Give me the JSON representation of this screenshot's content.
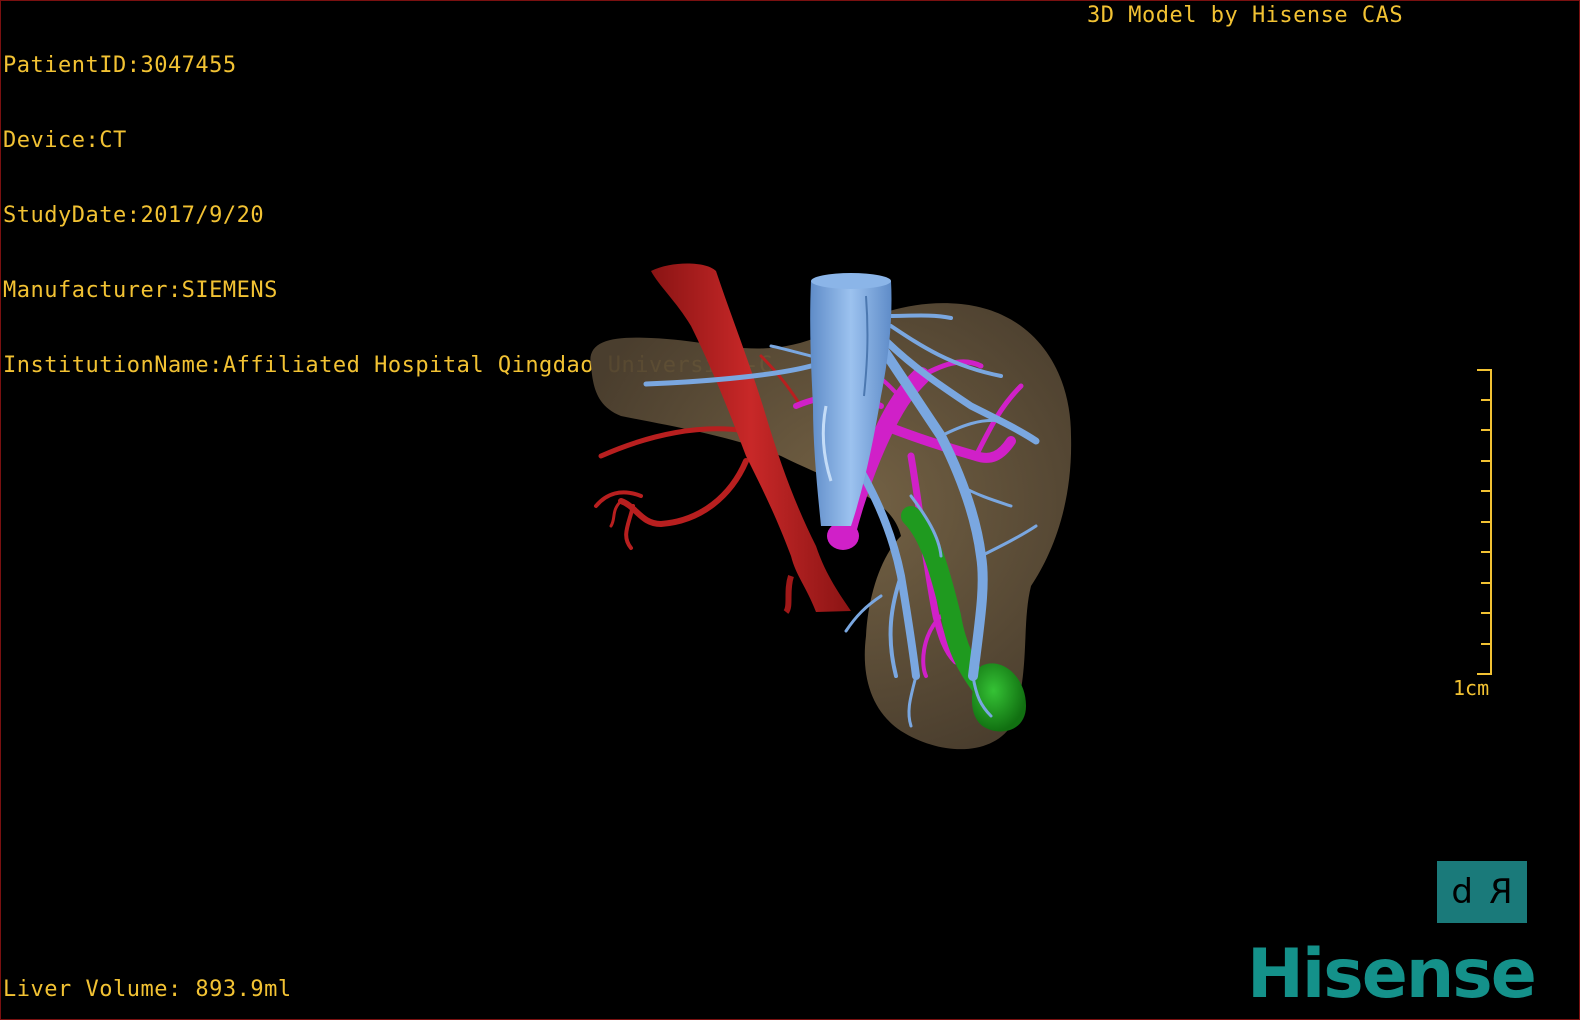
{
  "patient_info": {
    "patient_id": "PatientID:3047455",
    "device": "Device:CT",
    "study_date": "StudyDate:2017/9/20",
    "manufacturer": "Manufacturer:SIEMENS",
    "institution": "InstitutionName:Affiliated Hospital Qingdao University-C"
  },
  "credit": "3D Model by Hisense CAS",
  "liver_volume": "Liver Volume: 893.9ml",
  "scale": {
    "label": "1cm"
  },
  "orientation": {
    "left_glyph": "d",
    "right_glyph": "R"
  },
  "brand": "Hisense",
  "colors": {
    "overlay_text": "#f2c233",
    "liver": "#6b5a3e",
    "artery": "#b81f1f",
    "vena_cava": "#7aa7e0",
    "portal_vein": "#d020c8",
    "gallbladder": "#1f9a1f",
    "brand": "#14918a",
    "orientation_box": "#1a7a7a"
  }
}
